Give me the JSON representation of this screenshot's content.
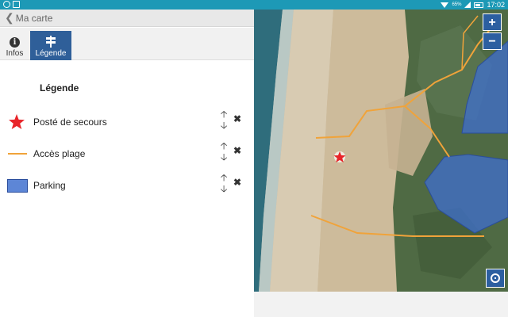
{
  "status_bar": {
    "battery": "65%",
    "time": "17:02"
  },
  "header": {
    "back_label": "Ma carte"
  },
  "tabs": [
    {
      "label": "Infos",
      "icon": "info-icon",
      "active": false
    },
    {
      "label": "Légende",
      "icon": "signpost-icon",
      "active": true
    }
  ],
  "legend": {
    "title": "Légende",
    "items": [
      {
        "label": "Posté de secours",
        "symbol": "red-star",
        "color": "#e8252a"
      },
      {
        "label": "Accès plage",
        "symbol": "orange-line",
        "color": "#f0a33a"
      },
      {
        "label": "Parking",
        "symbol": "blue-polygon",
        "color": "#5d86d6"
      }
    ]
  },
  "map": {
    "zoom_in_label": "+",
    "zoom_out_label": "−",
    "locate_icon": "locate-icon"
  },
  "colors": {
    "status_bar": "#1d99b6",
    "accent": "#2f5f99",
    "map_controls": "#2c5fa0"
  }
}
